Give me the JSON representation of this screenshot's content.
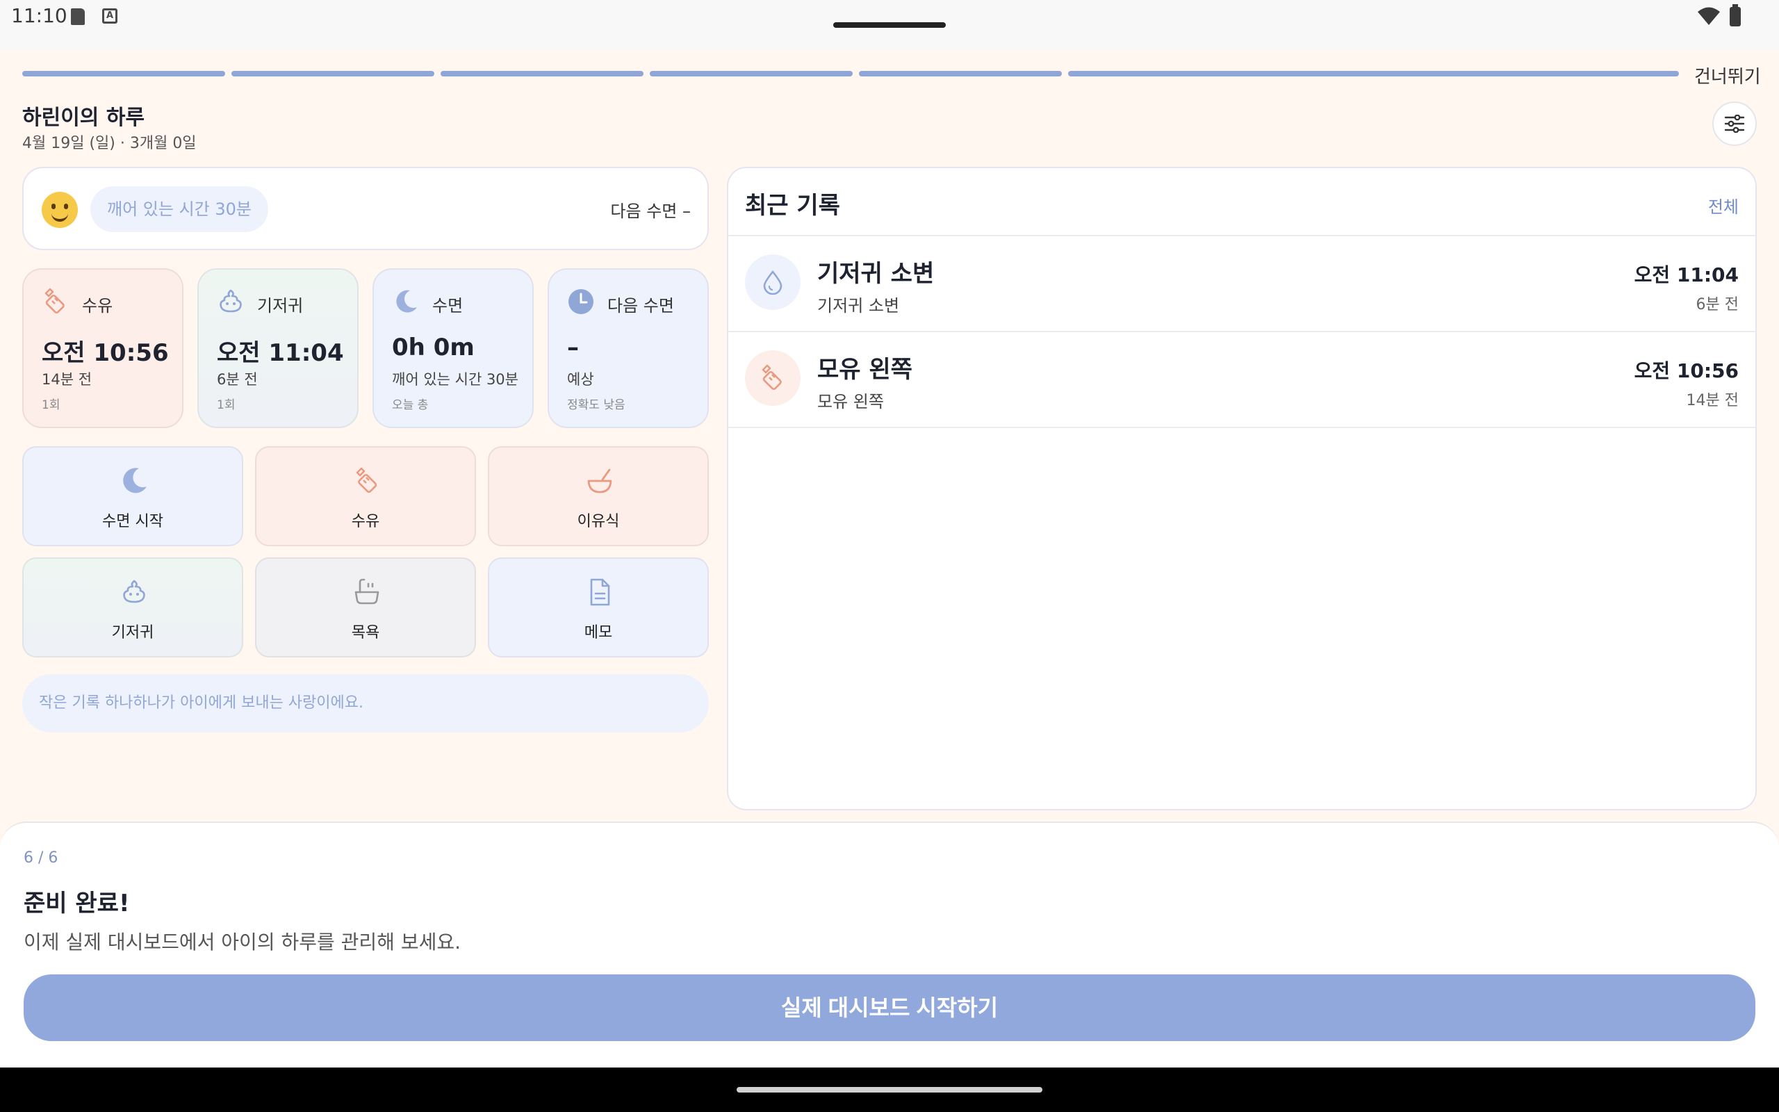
{
  "status_bar": {
    "time": "11:10",
    "notif_letter": "A"
  },
  "progress": {
    "segments": [
      1,
      1,
      1,
      1,
      1,
      1
    ]
  },
  "skip_label": "건너뛰기",
  "header": {
    "title": "하린이의 하루",
    "subtitle": "4월 19일 (일) · 3개월 0일"
  },
  "wake_card": {
    "chip": "깨어 있는 시간 30분",
    "next_sleep": "다음 수면 –"
  },
  "stats": [
    {
      "label": "수유",
      "value": "오전 10:56",
      "sub": "14분 전",
      "small": "1회",
      "icon": "bottle-icon"
    },
    {
      "label": "기저귀",
      "value": "오전 11:04",
      "sub": "6분 전",
      "small": "1회",
      "icon": "poop-icon"
    },
    {
      "label": "수면",
      "value": "0h 0m",
      "sub": "깨어 있는 시간 30분",
      "small": "오늘 총",
      "icon": "moon-icon"
    },
    {
      "label": "다음 수면",
      "value": "–",
      "sub": "예상",
      "small": "정확도 낮음",
      "icon": "clock-icon"
    }
  ],
  "actions": [
    {
      "label": "수면 시작",
      "icon": "moon-icon"
    },
    {
      "label": "수유",
      "icon": "bottle-icon"
    },
    {
      "label": "이유식",
      "icon": "bowl-icon"
    },
    {
      "label": "기저귀",
      "icon": "poop-icon"
    },
    {
      "label": "목욕",
      "icon": "bathtub-icon"
    },
    {
      "label": "메모",
      "icon": "memo-icon"
    }
  ],
  "quote": "작은 기록 하나하나가 아이에게 보내는 사랑이에요.",
  "recent": {
    "title": "최근 기록",
    "all_label": "전체",
    "items": [
      {
        "title": "기저귀 소변",
        "sub": "기저귀 소변",
        "time": "오전 11:04",
        "ago": "6분 전",
        "icon": "droplet-icon"
      },
      {
        "title": "모유 왼쪽",
        "sub": "모유 왼쪽",
        "time": "오전 10:56",
        "ago": "14분 전",
        "icon": "bottle-icon"
      }
    ]
  },
  "sheet": {
    "step": "6 / 6",
    "title": "준비 완료!",
    "desc": "이제 실제 대시보드에서 아이의 하루를 관리해 보세요.",
    "button": "실제 대시보드 시작하기"
  },
  "colors": {
    "accent": "#90a8db",
    "background": "#fff7f0",
    "feed_tint": "#fdeee9",
    "diaper_tint": "#eef4f1",
    "sleep_tint": "#eef2fc"
  }
}
